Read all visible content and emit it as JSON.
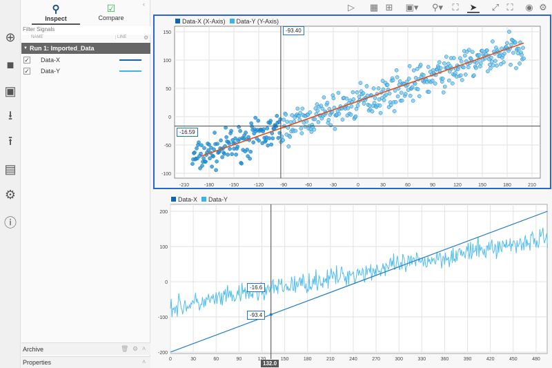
{
  "panel": {
    "tabs": [
      {
        "label": "Inspect",
        "icon": "search-icon",
        "active": true
      },
      {
        "label": "Compare",
        "icon": "compare-check-icon"
      }
    ],
    "filter_placeholder": "Filter Signals",
    "columns": {
      "name": "NAME",
      "line": "LINE"
    },
    "run": "Run 1: Imported_Data",
    "signals": [
      {
        "name": "Data-X",
        "checked": true,
        "color": "#0b64b4"
      },
      {
        "name": "Data-Y",
        "checked": true,
        "color": "#39b3ee"
      }
    ],
    "archive": "Archive",
    "properties": "Properties"
  },
  "top_plot": {
    "legend": [
      "Data-X (X-Axis)",
      "Data-Y (Y-Axis)"
    ],
    "cursor_x_label": "-93.40",
    "cursor_y_label": "-16.59",
    "x_ticks": [
      "-210",
      "-180",
      "-150",
      "-120",
      "-90",
      "-60",
      "-30",
      "0",
      "30",
      "60",
      "90",
      "120",
      "150",
      "180",
      "210"
    ],
    "y_ticks": [
      "150",
      "100",
      "50",
      "0",
      "-50",
      "-100"
    ]
  },
  "bottom_plot": {
    "legend": [
      "Data-X",
      "Data-Y"
    ],
    "cursor_time": "132.0",
    "label_y": "-16.6",
    "label_x": "-93.4",
    "x_ticks": [
      "0",
      "30",
      "60",
      "90",
      "120",
      "150",
      "180",
      "210",
      "240",
      "270",
      "300",
      "330",
      "360",
      "390",
      "420",
      "450",
      "480"
    ],
    "y_ticks": [
      "200",
      "100",
      "0",
      "-100",
      "-200"
    ]
  },
  "chart_data": [
    {
      "type": "scatter",
      "title": "Data-Y vs Data-X",
      "xlim": [
        -222,
        220
      ],
      "ylim": [
        -108,
        160
      ],
      "fit_line": {
        "from": [
          -190,
          -70
        ],
        "to": [
          200,
          130
        ],
        "color": "#e0501a"
      },
      "cursor": {
        "x": -93.4,
        "y": -16.59
      }
    },
    {
      "type": "line",
      "xlim": [
        0,
        495
      ],
      "ylim": [
        -205,
        215
      ],
      "series": [
        {
          "name": "Data-X",
          "from": -200,
          "to": 200
        },
        {
          "name": "Data-Y",
          "trend": "0.5*Data-X+25 with noise"
        }
      ],
      "cursor_t": 132.0
    }
  ],
  "colors": {
    "x": "#0b64b4",
    "y": "#39b3ee",
    "accent": "#2a62d8"
  }
}
